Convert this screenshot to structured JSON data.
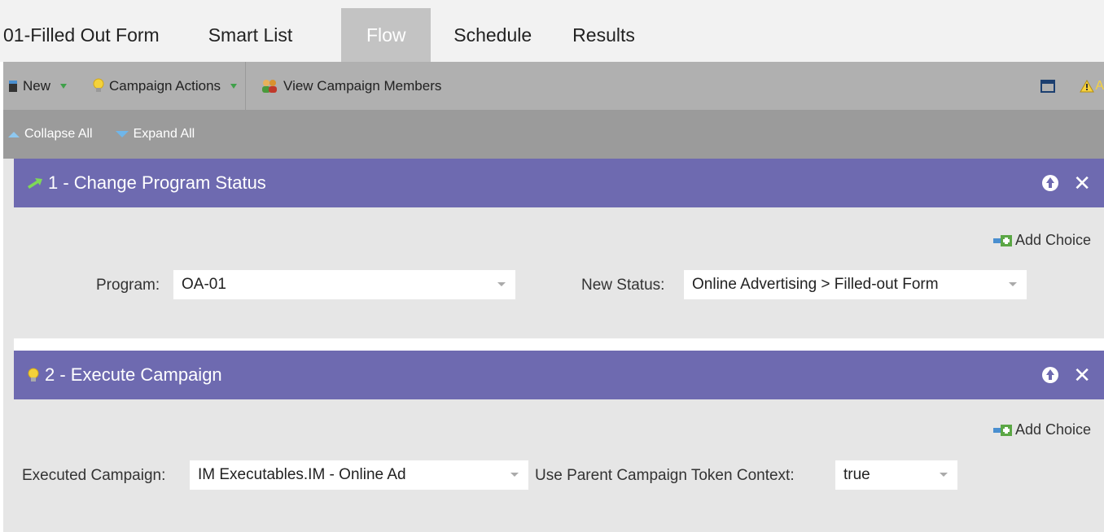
{
  "tabs": {
    "name": "01-Filled Out Form",
    "smart_list": "Smart List",
    "flow": "Flow",
    "schedule": "Schedule",
    "results": "Results"
  },
  "toolbar": {
    "new_label": "New",
    "campaign_actions_label": "Campaign Actions",
    "view_members_label": "View Campaign Members",
    "warning_partial": "A"
  },
  "subbar": {
    "collapse_all": "Collapse All",
    "expand_all": "Expand All"
  },
  "steps": [
    {
      "title": "1 - Change Program Status",
      "add_choice": "Add Choice",
      "field1_label": "Program:",
      "field1_value": "OA-01",
      "field2_label": "New Status:",
      "field2_value": "Online Advertising > Filled-out Form"
    },
    {
      "title": "2 - Execute Campaign",
      "add_choice": "Add Choice",
      "field1_label": "Executed Campaign:",
      "field1_value": "IM Executables.IM - Online Ad",
      "field2_label": "Use Parent Campaign Token Context:",
      "field2_value": "true"
    }
  ],
  "colors": {
    "header_purple": "#6e6ab0",
    "toolbar_gray": "#b0b0b0",
    "subbar_gray": "#9b9b9b",
    "active_tab": "#c3c3c3"
  }
}
